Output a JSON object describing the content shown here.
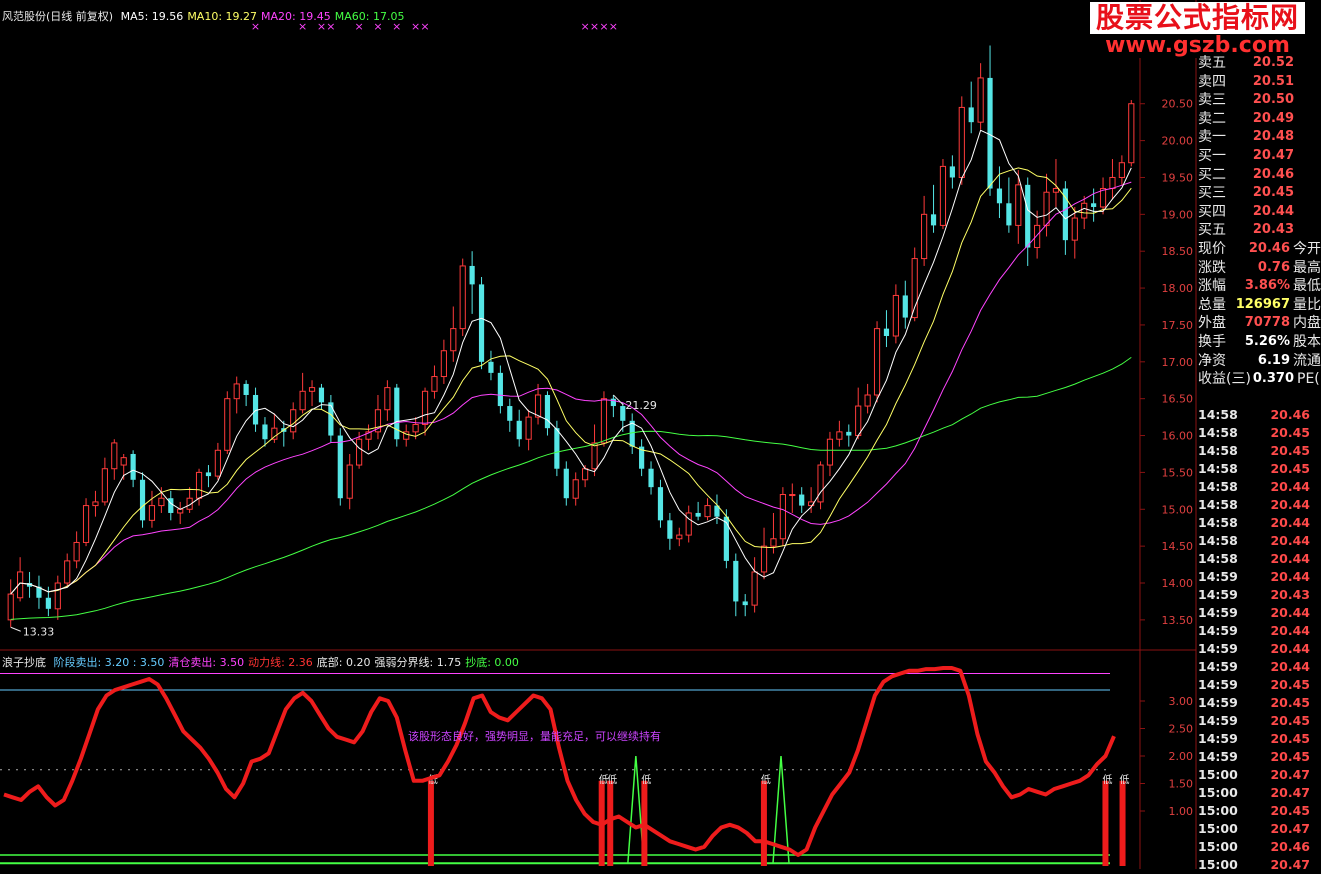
{
  "upper_legend": {
    "name": "风范股份(日线 前复权)",
    "items": [
      {
        "text": "MA5: 19.56",
        "color": "#ffffff"
      },
      {
        "text": "MA10: 19.27",
        "color": "#ffff66"
      },
      {
        "text": "MA20: 19.45",
        "color": "#ff44ff"
      },
      {
        "text": "MA60: 17.05",
        "color": "#44ff44"
      }
    ]
  },
  "lower_legend": {
    "name": "浪子抄底",
    "items": [
      {
        "text": "阶段卖出: 3.20 : 3.50",
        "color": "#66ccff"
      },
      {
        "text": "清仓卖出: 3.50",
        "color": "#ff44ff"
      },
      {
        "text": "动力线: 2.36",
        "color": "#ff3333"
      },
      {
        "text": "底部: 0.20",
        "color": "#e8e8e8"
      },
      {
        "text": "强弱分界线: 1.75",
        "color": "#e8e8e8"
      },
      {
        "text": "抄底: 0.00",
        "color": "#44ff44"
      }
    ]
  },
  "watermark": {
    "title": "股票公式指标网",
    "url": "www.gszb.com"
  },
  "quote": {
    "rows": [
      {
        "label": "卖五",
        "value": "20.52",
        "extra": ""
      },
      {
        "label": "卖四",
        "value": "20.51",
        "extra": ""
      },
      {
        "label": "卖三",
        "value": "20.50",
        "extra": ""
      },
      {
        "label": "卖二",
        "value": "20.49",
        "extra": ""
      },
      {
        "label": "卖一",
        "value": "20.48",
        "extra": ""
      },
      {
        "label": "买一",
        "value": "20.47",
        "extra": ""
      },
      {
        "label": "买二",
        "value": "20.46",
        "extra": ""
      },
      {
        "label": "买三",
        "value": "20.45",
        "extra": ""
      },
      {
        "label": "买四",
        "value": "20.44",
        "extra": ""
      },
      {
        "label": "买五",
        "value": "20.43",
        "extra": ""
      },
      {
        "label": "现价",
        "value": "20.46",
        "extra": "今开"
      },
      {
        "label": "涨跌",
        "value": "0.76",
        "extra": "最高"
      },
      {
        "label": "涨幅",
        "value": "3.86%",
        "extra": "最低"
      },
      {
        "label": "总量",
        "value": "126967",
        "extra": "量比",
        "color": "#ffff66"
      },
      {
        "label": "外盘",
        "value": "70778",
        "extra": "内盘"
      },
      {
        "label": "换手",
        "value": "5.26%",
        "extra": "股本",
        "color": "#ffffff"
      },
      {
        "label": "净资",
        "value": "6.19",
        "extra": "流通",
        "color": "#ffffff"
      },
      {
        "label": "收益(三)",
        "value": "0.370",
        "extra": "PE(",
        "color": "#ffffff"
      }
    ]
  },
  "trades": [
    {
      "time": "14:58",
      "price": "20.46"
    },
    {
      "time": "14:58",
      "price": "20.45"
    },
    {
      "time": "14:58",
      "price": "20.45"
    },
    {
      "time": "14:58",
      "price": "20.45"
    },
    {
      "time": "14:58",
      "price": "20.44"
    },
    {
      "time": "14:58",
      "price": "20.44"
    },
    {
      "time": "14:58",
      "price": "20.44"
    },
    {
      "time": "14:58",
      "price": "20.44"
    },
    {
      "time": "14:58",
      "price": "20.44"
    },
    {
      "time": "14:59",
      "price": "20.44"
    },
    {
      "time": "14:59",
      "price": "20.43"
    },
    {
      "time": "14:59",
      "price": "20.44"
    },
    {
      "time": "14:59",
      "price": "20.44"
    },
    {
      "time": "14:59",
      "price": "20.44"
    },
    {
      "time": "14:59",
      "price": "20.44"
    },
    {
      "time": "14:59",
      "price": "20.45"
    },
    {
      "time": "14:59",
      "price": "20.45"
    },
    {
      "time": "14:59",
      "price": "20.45"
    },
    {
      "time": "14:59",
      "price": "20.45"
    },
    {
      "time": "14:59",
      "price": "20.45"
    },
    {
      "time": "15:00",
      "price": "20.47"
    },
    {
      "time": "15:00",
      "price": "20.47"
    },
    {
      "time": "15:00",
      "price": "20.45"
    },
    {
      "time": "15:00",
      "price": "20.47"
    },
    {
      "time": "15:00",
      "price": "20.46"
    },
    {
      "time": "15:00",
      "price": "20.47"
    }
  ],
  "colors": {
    "up": "#ff3b3b",
    "down": "#55e6e6",
    "ma5": "#ffffff",
    "ma10": "#ffff66",
    "ma20": "#ff44ff",
    "ma60": "#44ff44",
    "power": "#ee1c1c",
    "bottom": "#44ff44",
    "grid": "#8a1212",
    "axis_text": "#e04040"
  },
  "chart_data": [
    {
      "type": "candlestick",
      "title": "风范股份(日线 前复权)",
      "ylim": [
        13.2,
        21.5
      ],
      "yticks": [
        13.5,
        14.0,
        14.5,
        15.0,
        15.5,
        16.0,
        16.5,
        17.0,
        17.5,
        18.0,
        18.5,
        19.0,
        19.5,
        20.0,
        20.5
      ],
      "annotations": [
        {
          "text": "21.29",
          "bar": 64
        },
        {
          "text": "13.33",
          "bar": 0
        }
      ],
      "marker_bars": [
        26,
        31,
        33,
        34,
        37,
        39,
        41,
        43,
        44,
        61,
        62,
        63,
        64
      ],
      "marker_symbol": "×",
      "candles": [
        [
          13.5,
          13.85,
          14.05,
          13.4
        ],
        [
          13.8,
          14.15,
          14.35,
          13.75
        ],
        [
          14.0,
          13.95,
          14.15,
          13.8
        ],
        [
          13.95,
          13.8,
          14.1,
          13.65
        ],
        [
          13.8,
          13.65,
          13.95,
          13.55
        ],
        [
          13.65,
          14.0,
          14.1,
          13.5
        ],
        [
          14.0,
          14.3,
          14.4,
          13.95
        ],
        [
          14.3,
          14.55,
          14.7,
          14.2
        ],
        [
          14.55,
          15.05,
          15.15,
          14.5
        ],
        [
          15.05,
          15.1,
          15.25,
          14.9
        ],
        [
          15.1,
          15.55,
          15.7,
          15.05
        ],
        [
          15.55,
          15.9,
          15.95,
          15.4
        ],
        [
          15.6,
          15.7,
          15.75,
          15.4
        ],
        [
          15.75,
          15.4,
          15.8,
          15.3
        ],
        [
          15.4,
          14.85,
          15.5,
          14.75
        ],
        [
          14.85,
          15.05,
          15.25,
          14.75
        ],
        [
          15.05,
          15.15,
          15.3,
          14.95
        ],
        [
          15.15,
          14.95,
          15.25,
          14.85
        ],
        [
          14.95,
          15.0,
          15.1,
          14.8
        ],
        [
          15.0,
          15.15,
          15.3,
          14.95
        ],
        [
          15.15,
          15.5,
          15.55,
          15.05
        ],
        [
          15.5,
          15.45,
          15.6,
          15.3
        ],
        [
          15.45,
          15.8,
          15.9,
          15.4
        ],
        [
          15.8,
          16.5,
          16.6,
          15.75
        ],
        [
          16.5,
          16.7,
          16.8,
          16.3
        ],
        [
          16.7,
          16.55,
          16.75,
          16.4
        ],
        [
          16.55,
          16.15,
          16.65,
          16.05
        ],
        [
          16.15,
          15.95,
          16.25,
          15.85
        ],
        [
          15.95,
          16.1,
          16.3,
          15.9
        ],
        [
          16.1,
          16.05,
          16.2,
          15.85
        ],
        [
          16.05,
          16.35,
          16.45,
          15.95
        ],
        [
          16.35,
          16.6,
          16.85,
          16.3
        ],
        [
          16.6,
          16.65,
          16.75,
          16.4
        ],
        [
          16.65,
          16.45,
          16.7,
          16.35
        ],
        [
          16.45,
          16.0,
          16.55,
          15.9
        ],
        [
          16.0,
          15.15,
          16.1,
          15.05
        ],
        [
          15.15,
          15.6,
          15.75,
          15.0
        ],
        [
          15.6,
          15.95,
          16.05,
          15.55
        ],
        [
          15.95,
          16.05,
          16.15,
          15.8
        ],
        [
          16.05,
          16.35,
          16.55,
          15.95
        ],
        [
          16.35,
          16.65,
          16.75,
          16.2
        ],
        [
          16.65,
          15.95,
          16.7,
          15.85
        ],
        [
          15.95,
          16.05,
          16.15,
          15.85
        ],
        [
          16.05,
          16.15,
          16.25,
          15.95
        ],
        [
          16.15,
          16.6,
          16.65,
          16.0
        ],
        [
          16.6,
          16.8,
          16.95,
          16.5
        ],
        [
          16.8,
          17.15,
          17.3,
          16.7
        ],
        [
          17.15,
          17.45,
          17.75,
          17.0
        ],
        [
          17.45,
          18.3,
          18.4,
          17.35
        ],
        [
          18.3,
          18.05,
          18.5,
          17.65
        ],
        [
          18.05,
          17.0,
          18.15,
          16.9
        ],
        [
          17.0,
          16.85,
          17.15,
          16.75
        ],
        [
          16.85,
          16.4,
          16.95,
          16.3
        ],
        [
          16.4,
          16.2,
          16.5,
          16.05
        ],
        [
          16.2,
          15.95,
          16.35,
          15.85
        ],
        [
          15.95,
          16.25,
          16.35,
          15.8
        ],
        [
          16.25,
          16.55,
          16.7,
          16.15
        ],
        [
          16.55,
          16.1,
          16.6,
          16.0
        ],
        [
          16.1,
          15.55,
          16.2,
          15.45
        ],
        [
          15.55,
          15.15,
          15.65,
          15.05
        ],
        [
          15.15,
          15.4,
          15.5,
          15.05
        ],
        [
          15.4,
          15.55,
          15.6,
          15.3
        ],
        [
          15.55,
          15.9,
          16.15,
          15.45
        ],
        [
          15.9,
          16.5,
          16.6,
          15.85
        ],
        [
          16.5,
          16.4,
          16.55,
          16.25
        ],
        [
          16.4,
          16.2,
          16.45,
          16.05
        ],
        [
          16.2,
          15.85,
          16.3,
          15.75
        ],
        [
          15.85,
          15.55,
          15.95,
          15.45
        ],
        [
          15.55,
          15.3,
          15.65,
          15.2
        ],
        [
          15.3,
          14.85,
          15.4,
          14.75
        ],
        [
          14.85,
          14.6,
          14.95,
          14.45
        ],
        [
          14.6,
          14.65,
          14.75,
          14.5
        ],
        [
          14.65,
          14.95,
          15.05,
          14.55
        ],
        [
          14.95,
          14.9,
          15.1,
          14.85
        ],
        [
          14.9,
          15.05,
          15.15,
          14.85
        ],
        [
          15.05,
          14.9,
          15.2,
          14.8
        ],
        [
          14.9,
          14.3,
          15.0,
          14.2
        ],
        [
          14.3,
          13.75,
          14.4,
          13.55
        ],
        [
          13.75,
          13.7,
          13.85,
          13.55
        ],
        [
          13.7,
          14.15,
          14.35,
          13.6
        ],
        [
          14.15,
          14.5,
          14.75,
          14.05
        ],
        [
          14.5,
          14.6,
          14.95,
          14.4
        ],
        [
          14.6,
          15.2,
          15.3,
          14.5
        ],
        [
          15.2,
          15.2,
          15.35,
          14.95
        ],
        [
          15.2,
          15.05,
          15.3,
          14.95
        ],
        [
          15.05,
          15.1,
          15.3,
          14.95
        ],
        [
          15.1,
          15.6,
          15.65,
          15.0
        ],
        [
          15.6,
          15.95,
          16.05,
          15.45
        ],
        [
          15.95,
          16.05,
          16.2,
          15.85
        ],
        [
          16.05,
          16.0,
          16.15,
          15.85
        ],
        [
          16.0,
          16.4,
          16.65,
          15.95
        ],
        [
          16.4,
          16.55,
          16.7,
          16.3
        ],
        [
          16.55,
          17.45,
          17.55,
          16.45
        ],
        [
          17.45,
          17.35,
          17.7,
          17.2
        ],
        [
          17.35,
          17.9,
          18.05,
          17.25
        ],
        [
          17.9,
          17.6,
          18.1,
          17.45
        ],
        [
          17.6,
          18.4,
          18.55,
          17.55
        ],
        [
          18.4,
          19.0,
          19.25,
          18.3
        ],
        [
          19.0,
          18.85,
          19.4,
          18.75
        ],
        [
          18.85,
          19.65,
          19.75,
          18.8
        ],
        [
          19.65,
          19.5,
          19.8,
          19.35
        ],
        [
          19.5,
          20.45,
          20.6,
          19.4
        ],
        [
          20.45,
          20.25,
          20.8,
          20.1
        ],
        [
          20.25,
          20.85,
          21.05,
          20.15
        ],
        [
          20.85,
          19.35,
          21.29,
          19.25
        ],
        [
          19.35,
          19.15,
          19.65,
          18.95
        ],
        [
          19.15,
          18.85,
          19.5,
          18.75
        ],
        [
          18.85,
          19.4,
          19.6,
          18.6
        ],
        [
          19.4,
          18.55,
          19.5,
          18.3
        ],
        [
          18.55,
          18.85,
          19.05,
          18.4
        ],
        [
          18.85,
          19.3,
          19.55,
          18.7
        ],
        [
          19.3,
          19.35,
          19.75,
          19.1
        ],
        [
          19.35,
          18.65,
          19.45,
          18.45
        ],
        [
          18.65,
          18.95,
          19.1,
          18.4
        ],
        [
          18.95,
          19.15,
          19.25,
          18.8
        ],
        [
          19.15,
          19.1,
          19.35,
          18.9
        ],
        [
          19.1,
          19.35,
          19.5,
          19.0
        ],
        [
          19.35,
          19.5,
          19.75,
          19.2
        ],
        [
          19.5,
          19.7,
          19.8,
          19.4
        ],
        [
          19.7,
          20.5,
          20.55,
          19.65
        ]
      ]
    },
    {
      "type": "line",
      "title": "浪子抄底",
      "ylim": [
        0.0,
        3.6
      ],
      "yticks": [
        1.0,
        1.5,
        2.0,
        2.5,
        3.0
      ],
      "levels": {
        "阶段卖出": [
          3.2,
          3.5
        ],
        "清仓卖出": 3.5,
        "底部": 0.2,
        "强弱分界线": 1.75
      },
      "comment": "该股形态良好，强势明显，量能充足，可以继续持有",
      "signal_label": "低",
      "power_line": [
        1.3,
        1.25,
        1.2,
        1.35,
        1.45,
        1.25,
        1.1,
        1.2,
        1.55,
        1.95,
        2.4,
        2.85,
        3.1,
        3.2,
        3.25,
        3.3,
        3.35,
        3.4,
        3.3,
        3.05,
        2.75,
        2.45,
        2.3,
        2.15,
        1.95,
        1.7,
        1.4,
        1.25,
        1.5,
        1.9,
        1.95,
        2.05,
        2.45,
        2.85,
        3.05,
        3.15,
        3.0,
        2.75,
        2.5,
        2.35,
        2.3,
        2.25,
        2.45,
        2.8,
        3.05,
        3.0,
        2.7,
        2.1,
        1.55,
        1.55,
        1.6,
        1.65,
        1.9,
        2.2,
        2.6,
        3.05,
        3.1,
        2.8,
        2.7,
        2.65,
        2.8,
        2.95,
        3.1,
        3.05,
        2.85,
        2.15,
        1.55,
        1.2,
        0.95,
        0.8,
        0.75,
        0.85,
        0.9,
        0.8,
        0.7,
        0.75,
        0.65,
        0.55,
        0.45,
        0.4,
        0.35,
        0.3,
        0.35,
        0.55,
        0.7,
        0.75,
        0.7,
        0.6,
        0.45,
        0.45,
        0.4,
        0.35,
        0.3,
        0.2,
        0.3,
        0.7,
        1.0,
        1.3,
        1.5,
        1.7,
        2.1,
        2.6,
        3.1,
        3.35,
        3.45,
        3.5,
        3.55,
        3.55,
        3.58,
        3.58,
        3.6,
        3.6,
        3.55,
        3.1,
        2.4,
        1.9,
        1.7,
        1.45,
        1.25,
        1.3,
        1.4,
        1.35,
        1.3,
        1.4,
        1.45,
        1.5,
        1.55,
        1.65,
        1.85,
        2.0,
        2.36
      ],
      "bottom_signals": [
        50,
        70,
        71,
        75,
        89,
        129,
        131
      ],
      "bottom_line_spikes": [
        74,
        91
      ]
    }
  ]
}
